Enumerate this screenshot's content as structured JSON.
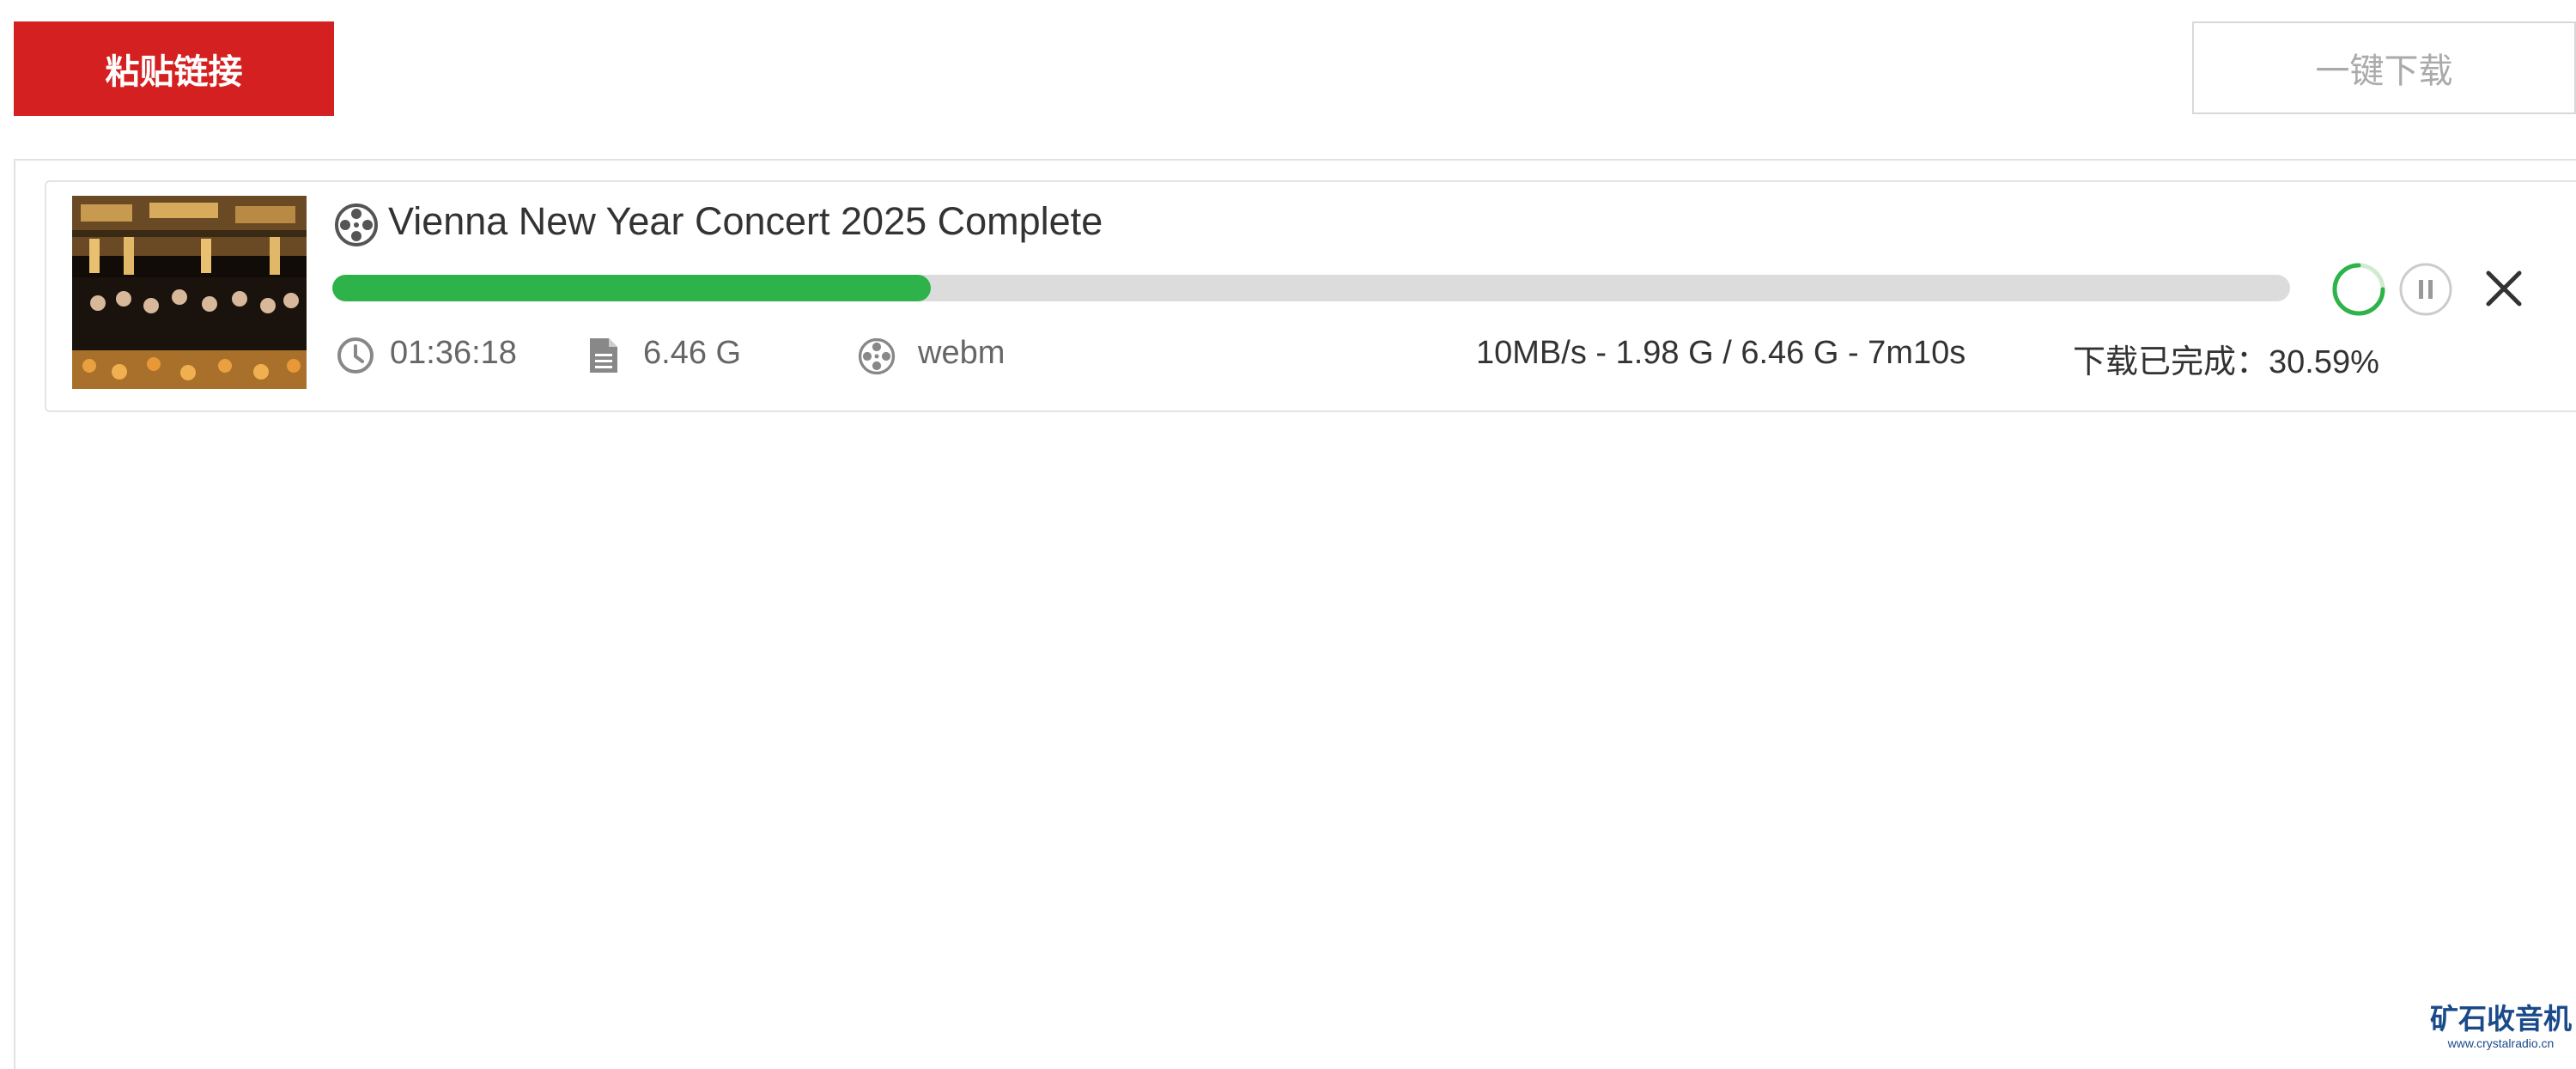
{
  "toolbar": {
    "paste_label": "粘贴链接",
    "download_all_label": "一键下载"
  },
  "task": {
    "title": "Vienna New Year Concert 2025 Complete",
    "duration": "01:36:18",
    "size": "6.46 G",
    "format": "webm",
    "status": "10MB/s - 1.98 G / 6.46 G - 7m10s",
    "completion": "下载已完成：30.59%",
    "progress_percent": 30.59,
    "progress_color": "#2db34a",
    "icons": {
      "title": "film-reel-icon",
      "duration": "clock-icon",
      "size": "document-icon",
      "format": "film-reel-icon",
      "spinner": "loading-spinner-icon",
      "pause": "pause-icon",
      "close": "close-icon"
    }
  },
  "watermark": {
    "title": "矿石收音机",
    "url": "www.crystalradio.cn"
  },
  "colors": {
    "accent_red": "#d42020",
    "progress_green": "#2db34a",
    "track_gray": "#dcdcdc"
  }
}
